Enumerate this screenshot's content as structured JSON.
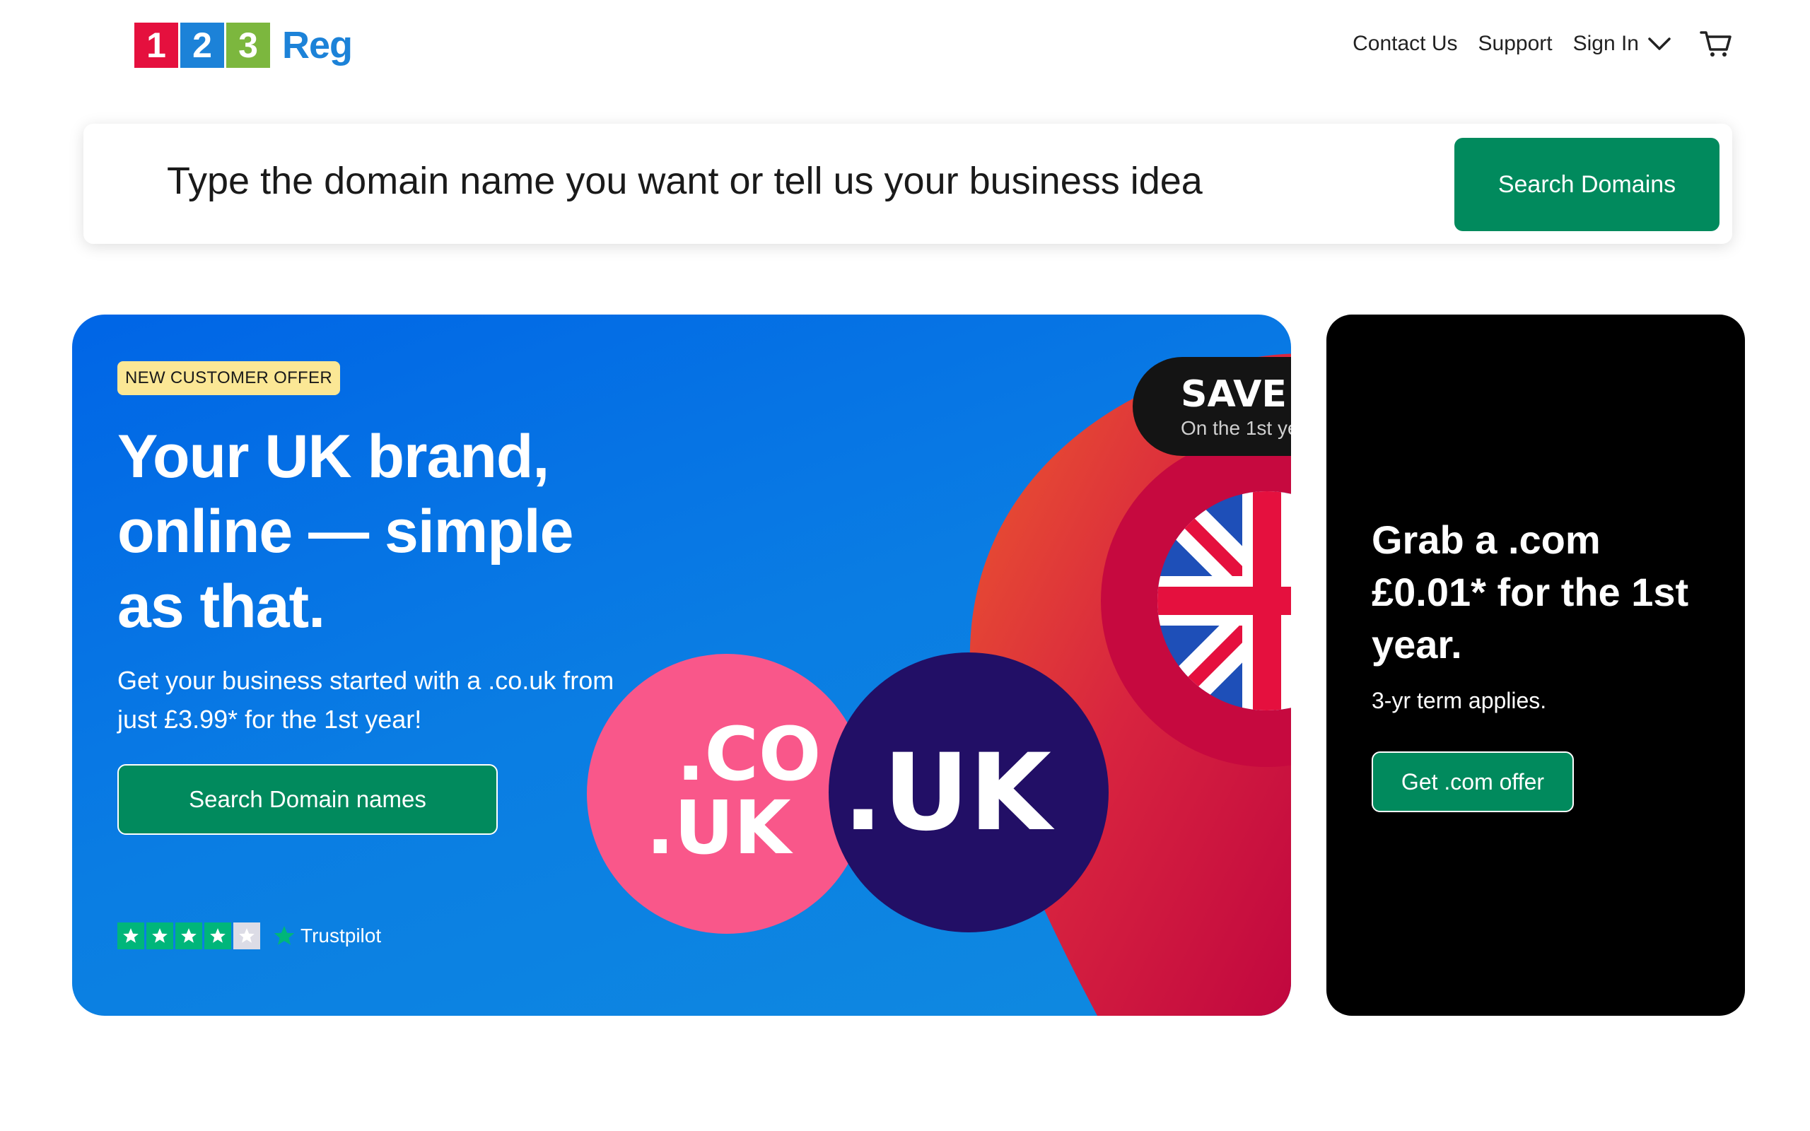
{
  "brand": {
    "logo_digits": [
      "1",
      "2",
      "3"
    ],
    "logo_text": "Reg",
    "colors": {
      "red": "#e5103e",
      "blue": "#1c82d8",
      "green": "#7cb73e"
    }
  },
  "nav": {
    "contact": "Contact Us",
    "support": "Support",
    "signin": "Sign In",
    "signin_icon": "chevron-down-icon",
    "cart_icon": "cart-icon"
  },
  "search": {
    "placeholder": "Type the domain name you want or tell us your business idea",
    "button": "Search Domains"
  },
  "hero": {
    "badge": "NEW CUSTOMER OFFER",
    "headline": "Your UK brand, online — simple as that.",
    "subtext": "Get your business started with a .co.uk from just £3.99* for the 1st year!",
    "cta": "Search Domain names",
    "trustpilot": {
      "label": "Trustpilot",
      "rating_stars": 4,
      "max_stars": 5
    },
    "art": {
      "pill_title": "SAVE",
      "pill_sub": "On the 1st ye",
      "couk_line1": ".CO",
      "couk_line2": ".UK",
      "uk": ".UK"
    }
  },
  "promo": {
    "title": "Grab a .com £0.01* for the 1st year.",
    "terms": "3-yr term applies.",
    "button": "Get .com offer"
  },
  "accent_colors": {
    "primary_green": "#018a5d",
    "hero_blue": "#0065e6",
    "badge_yellow": "#fbe795",
    "trustpilot_green": "#00b67a"
  }
}
